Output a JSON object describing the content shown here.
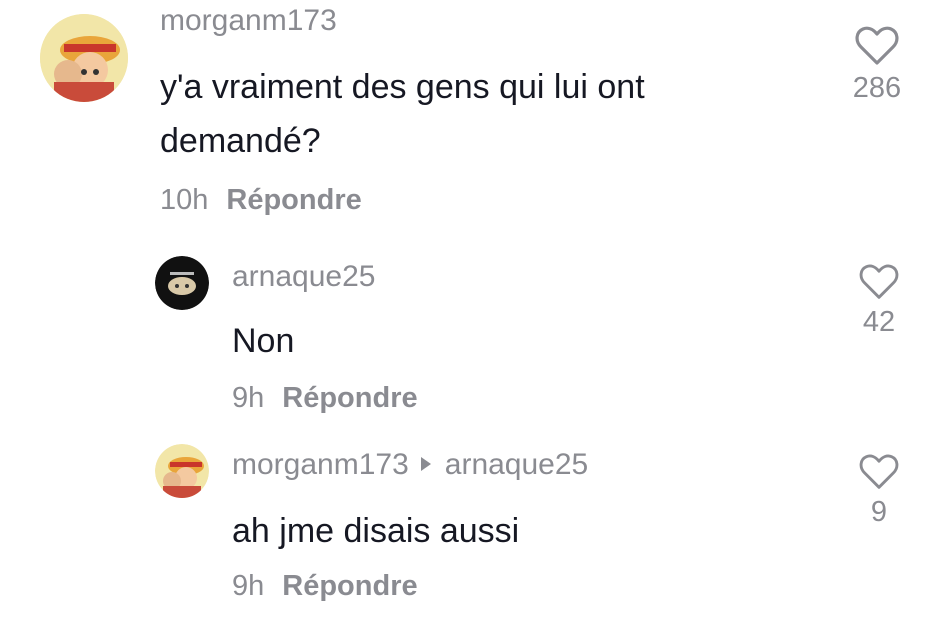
{
  "comments": [
    {
      "username": "morganm173",
      "text": "y'a vraiment des gens qui lui ont demandé?",
      "time": "10h",
      "reply_label": "Répondre",
      "likes": "286"
    },
    {
      "username": "arnaque25",
      "text": "Non",
      "time": "9h",
      "reply_label": "Répondre",
      "likes": "42"
    },
    {
      "username": "morganm173",
      "reply_to": "arnaque25",
      "text": "ah jme disais aussi",
      "time": "9h",
      "reply_label": "Répondre",
      "likes": "9"
    }
  ],
  "colors": {
    "text_primary": "#161823",
    "text_secondary": "#8a8b91",
    "background": "#ffffff"
  },
  "icons": {
    "like": "heart-outline-icon",
    "reply_arrow": "triangle-right-icon"
  }
}
